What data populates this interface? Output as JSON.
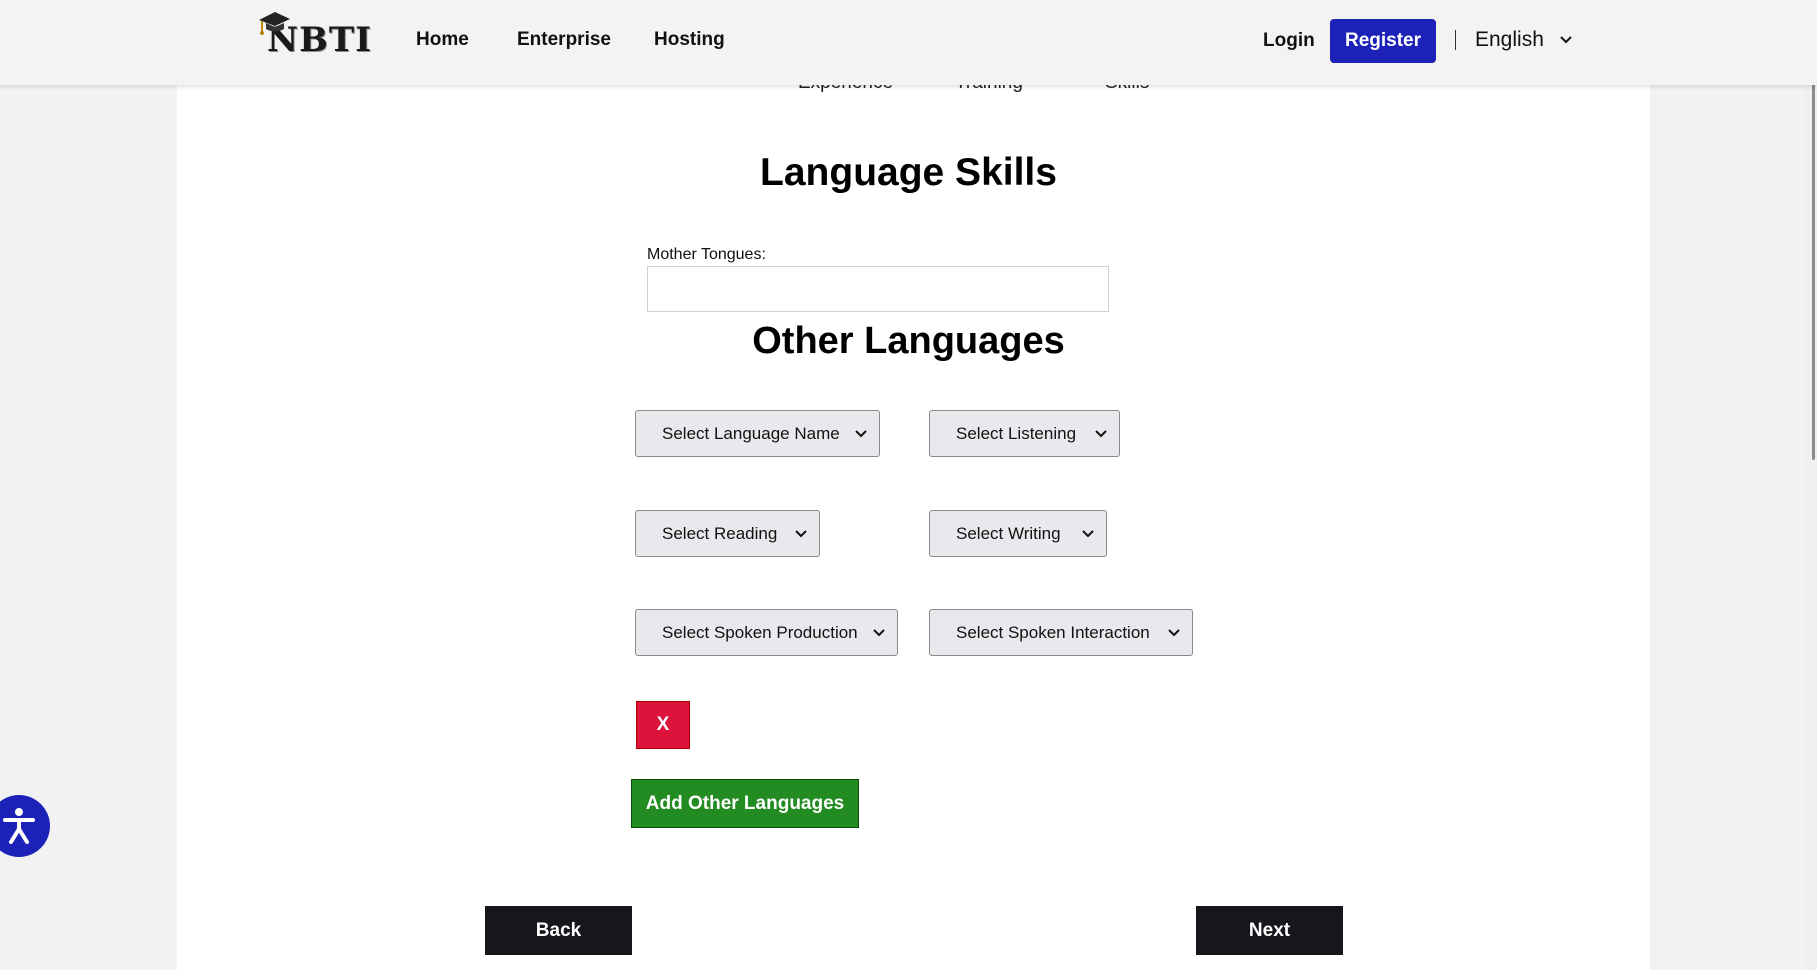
{
  "header": {
    "logo_text": "NBTI",
    "nav": [
      {
        "label": "Home"
      },
      {
        "label": "Enterprise"
      },
      {
        "label": "Hosting"
      }
    ],
    "login_label": "Login",
    "register_label": "Register",
    "language_label": "English",
    "icons": {
      "logo": "graduation-cap-icon",
      "language_dropdown": "chevron-down-icon"
    }
  },
  "stepper": {
    "steps": [
      "Experience",
      "Training",
      "Skills"
    ]
  },
  "main": {
    "title": "Language Skills",
    "mother_tongues_label": "Mother Tongues:",
    "mother_tongues_value": "",
    "other_languages_title": "Other Languages",
    "selects": {
      "language_name": "Select Language Name",
      "listening": "Select Listening",
      "reading": "Select Reading",
      "writing": "Select Writing",
      "spoken_production": "Select Spoken Production",
      "spoken_interaction": "Select Spoken Interaction"
    },
    "remove_label": "X",
    "add_label": "Add Other Languages",
    "back_label": "Back",
    "next_label": "Next"
  },
  "accessibility": {
    "icon": "accessibility-icon"
  },
  "colors": {
    "brand_blue": "#1c22b8",
    "remove_red": "#dc143c",
    "add_green": "#228b22",
    "nav_dark": "#15171c"
  }
}
